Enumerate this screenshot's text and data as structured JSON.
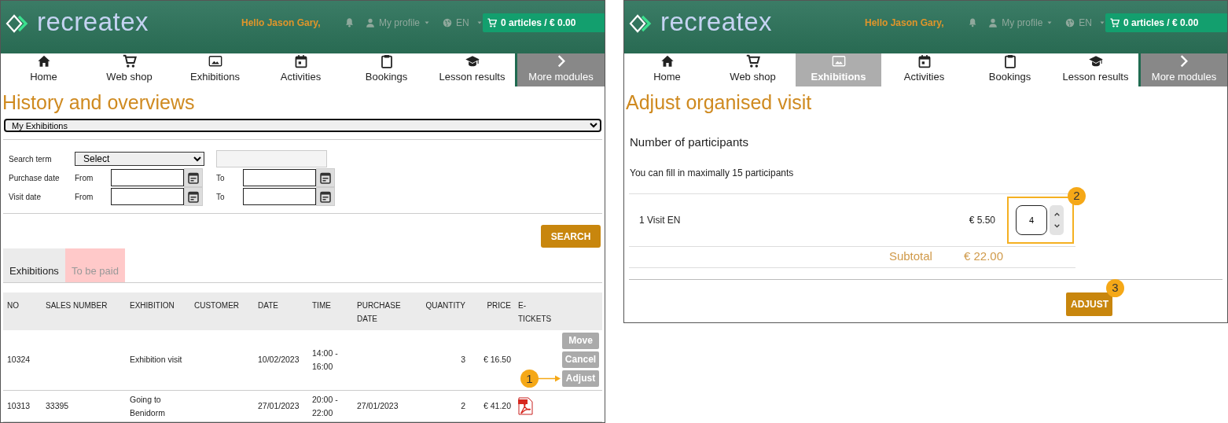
{
  "history_page": {
    "header": {
      "logo": "recreatex",
      "greeting": "Hello Jason Gary,",
      "profile": "My profile",
      "language": "EN",
      "cart": "0 articles / € 0.00"
    },
    "nav": [
      {
        "label": "Home",
        "kind": "module",
        "selected": false
      },
      {
        "label": "Web shop",
        "kind": "module",
        "selected": false
      },
      {
        "label": "Exhibitions",
        "kind": "module",
        "selected": false
      },
      {
        "label": "Activities",
        "kind": "module",
        "selected": false
      },
      {
        "label": "Bookings",
        "kind": "module",
        "selected": false
      },
      {
        "label": "Lesson results",
        "kind": "module",
        "selected": false
      },
      {
        "label": "More modules",
        "kind": "more",
        "selected": false
      }
    ],
    "title": "History and overviews",
    "view_select": "My Exhibitions",
    "search_form": {
      "search_term_label": "Search term",
      "search_term_value": "Select",
      "date_rows": [
        {
          "label": "Purchase date",
          "from": "From",
          "to": "To"
        },
        {
          "label": "Visit date",
          "from": "From",
          "to": "To"
        }
      ],
      "button": "SEARCH"
    },
    "tabs": [
      {
        "label": "Exhibitions",
        "selected": true
      },
      {
        "label": "To be paid",
        "selected": false
      }
    ],
    "table": {
      "columns": [
        "NO",
        "SALES NUMBER",
        "EXHIBITION",
        "CUSTOMER",
        "DATE",
        "TIME",
        "PURCHASE DATE",
        "QUANTITY",
        "PRICE",
        "E-TICKETS"
      ],
      "rows": [
        {
          "no": "10324",
          "exhibition": "Exhibition visit",
          "date": "10/02/2023",
          "time": "14:00 - 16:00",
          "quantity": "3",
          "price": "€ 16.50",
          "actions": [
            {
              "label": "Move"
            },
            {
              "label": "Cancel"
            },
            {
              "label": "Adjust",
              "step": "1"
            }
          ]
        },
        {
          "no": "10313",
          "sales_number": "33395",
          "exhibition": "Going to Benidorm",
          "date": "27/01/2023",
          "time": "20:00 - 22:00",
          "purchase_date": "27/01/2023",
          "quantity": "2",
          "price": "€ 41.20",
          "e_ticket": true
        }
      ]
    }
  },
  "adjust_page": {
    "header": {
      "logo": "recreatex",
      "greeting": "Hello Jason Gary,",
      "profile": "My profile",
      "language": "EN",
      "cart": "0 articles / € 0.00"
    },
    "nav": [
      {
        "label": "Home",
        "kind": "module",
        "selected": false
      },
      {
        "label": "Web shop",
        "kind": "module",
        "selected": false
      },
      {
        "label": "Exhibitions",
        "kind": "module",
        "selected": true
      },
      {
        "label": "Activities",
        "kind": "module",
        "selected": false
      },
      {
        "label": "Bookings",
        "kind": "module",
        "selected": false
      },
      {
        "label": "Lesson results",
        "kind": "module",
        "selected": false
      },
      {
        "label": "More modules",
        "kind": "more",
        "selected": false
      }
    ],
    "title": "Adjust organised visit",
    "section_title": "Number of participants",
    "hint": "You can fill in maximally 15 participants",
    "items": [
      {
        "name": "1 Visit EN",
        "price": "€ 5.50",
        "quantity": "4",
        "step": "2"
      }
    ],
    "subtotal_label": "Subtotal",
    "subtotal_value": "€ 22.00",
    "button": {
      "label": "ADJUST",
      "step": "3"
    }
  }
}
